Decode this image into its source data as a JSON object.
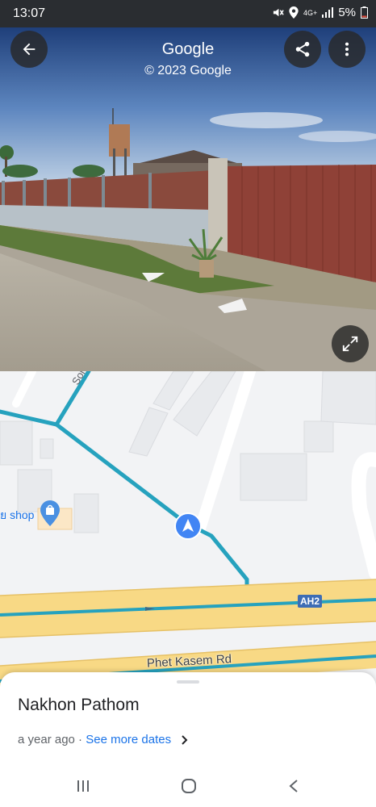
{
  "status_bar": {
    "time": "13:07",
    "network": "4G+",
    "battery": "5%"
  },
  "streetview": {
    "title": "Google",
    "copyright": "© 2023 Google"
  },
  "map": {
    "road_labels": {
      "soi": "Soi ch",
      "highway_shield": "AH2",
      "main_road": "Phet Kasem Rd"
    },
    "poi_label": "ย shop"
  },
  "sheet": {
    "title": "Nakhon Pathom",
    "date": "a year ago · ",
    "see_more": "See more dates"
  },
  "colors": {
    "route": "#26a2be",
    "highway": "#f8d985",
    "accent": "#1a73e8"
  }
}
